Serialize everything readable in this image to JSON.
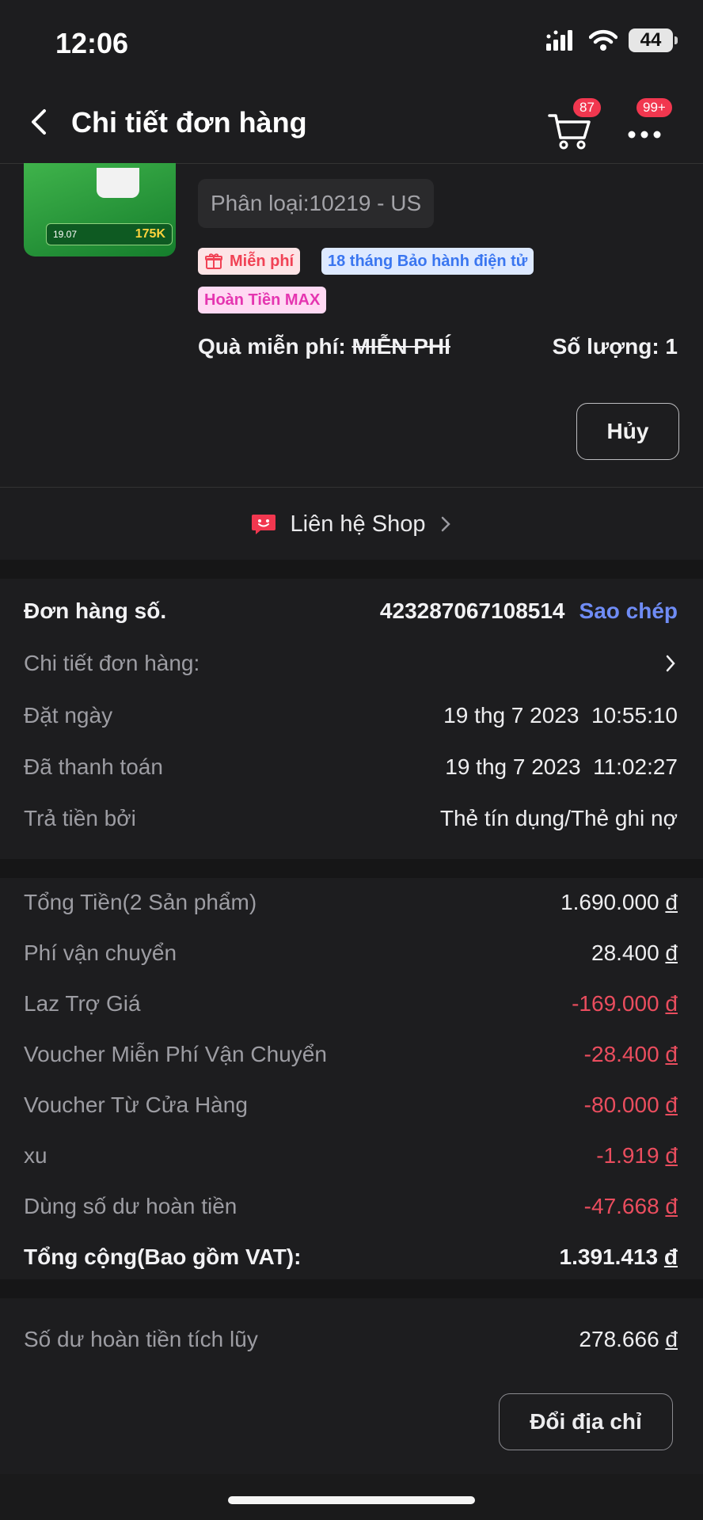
{
  "status": {
    "time": "12:06",
    "battery": "44"
  },
  "header": {
    "title": "Chi tiết đơn hàng",
    "cart_badge": "87",
    "more_badge": "99+"
  },
  "product": {
    "variant": "Phân loại:10219 -  US",
    "tags": {
      "free": "Miễn phí",
      "warranty": "18 tháng Bảo hành điện tử",
      "cashback": "Hoàn Tiền MAX"
    },
    "gift_label": "Quà miễn phí:",
    "gift_value": "MIỄN PHÍ",
    "quantity": "Số lượng: 1",
    "img_text": {
      "date_label": "19.07",
      "price": "175K"
    }
  },
  "actions": {
    "cancel": "Hủy",
    "contact_shop": "Liên hệ Shop",
    "change_address": "Đổi địa chỉ"
  },
  "order": {
    "number_label": "Đơn hàng số.",
    "number": "423287067108514",
    "copy": "Sao chép",
    "details_label": "Chi tiết đơn hàng:",
    "placed_label": "Đặt ngày",
    "placed_value": "19 thg 7 2023  10:55:10",
    "paid_label": "Đã thanh toán",
    "paid_value": "19 thg 7 2023  11:02:27",
    "pay_by_label": "Trả tiền bởi",
    "pay_by_value": "Thẻ tín dụng/Thẻ ghi nợ"
  },
  "summary": {
    "subtotal_label": "Tổng Tiền(2 Sản phẩm)",
    "subtotal": "1.690.000",
    "shipping_label": "Phí vận chuyển",
    "shipping": "28.400",
    "subsidy_label": "Laz Trợ Giá",
    "subsidy": "-169.000",
    "free_ship_label": "Voucher Miễn Phí Vận Chuyển",
    "free_ship": "-28.400",
    "shop_voucher_label": "Voucher Từ Cửa Hàng",
    "shop_voucher": "-80.000",
    "coins_label": "xu",
    "coins": "-1.919",
    "refund_balance_label": "Dùng số dư hoàn tiền",
    "refund_balance": "-47.668",
    "total_label": "Tổng cộng(Bao gồm VAT):",
    "total": "1.391.413",
    "currency": "đ"
  },
  "cashback": {
    "label": "Số dư hoàn tiền tích lũy",
    "value": "278.666"
  },
  "colors": {
    "negative": "#ea4d5e",
    "link": "#6f8cf5",
    "accent": "#f1374f"
  }
}
